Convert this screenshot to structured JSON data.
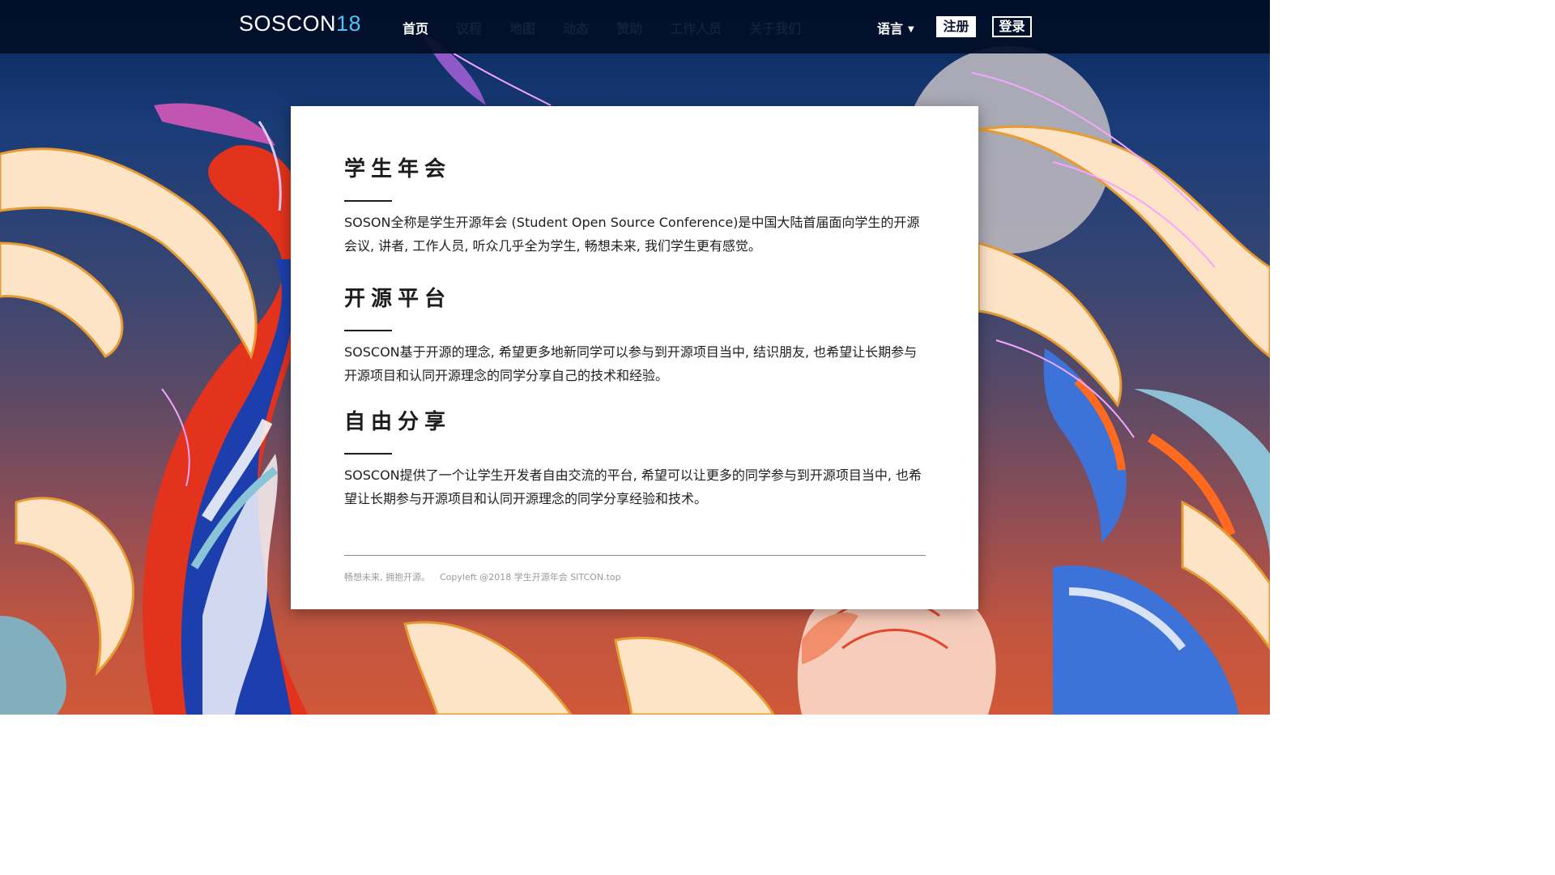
{
  "brand": {
    "name": "SOSCON",
    "year": "18"
  },
  "nav": {
    "items": [
      {
        "label": "首页",
        "active": true
      },
      {
        "label": "议程",
        "active": false
      },
      {
        "label": "地图",
        "active": false
      },
      {
        "label": "动态",
        "active": false
      },
      {
        "label": "赞助",
        "active": false
      },
      {
        "label": "工作人员",
        "active": false
      },
      {
        "label": "关于我们",
        "active": false
      }
    ],
    "language_label": "语言",
    "register_label": "注册",
    "login_label": "登录"
  },
  "sections": [
    {
      "heading": "学生年会",
      "body": "SOSON全称是学生开源年会 (Student Open Source Conference)是中国大陆首届面向学生的开源会议, 讲者, 工作人员, 听众几乎全为学生, 畅想未来, 我们学生更有感觉。"
    },
    {
      "heading": "开源平台",
      "body": "SOSCON基于开源的理念, 希望更多地新同学可以参与到开源项目当中, 结识朋友, 也希望让长期参与开源项目和认同开源理念的同学分享自己的技术和经验。"
    },
    {
      "heading": "自由分享",
      "body": "SOSCON提供了一个让学生开发者自由交流的平台, 希望可以让更多的同学参与到开源项目当中, 也希望让长期参与开源项目和认同开源理念的同学分享经验和技术。"
    }
  ],
  "footer": {
    "slogan": "畅想未来, 拥抱开源。",
    "copyright": "Copyleft @2018 学生开源年会 SITCON.top"
  },
  "colors": {
    "nav_bg": "#020e28",
    "logo_year": "#4fc3f7",
    "card_bg": "#ffffff",
    "text": "#1e1e1e"
  }
}
